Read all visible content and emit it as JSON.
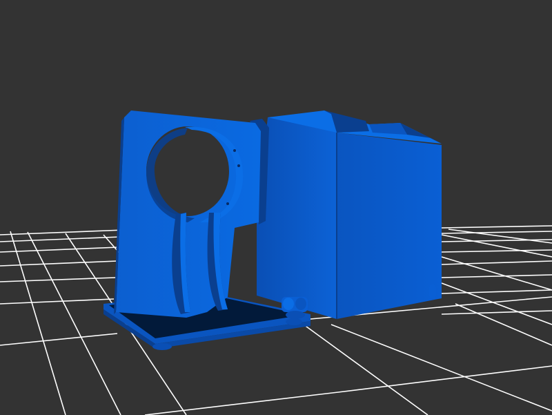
{
  "scene": {
    "background_color": "#333333",
    "grid_color": "#ffffff",
    "model_color": "#0a64d8",
    "model_dark": "#0a3f8f",
    "model_darker": "#062a66",
    "model_light": "#1a78ec"
  },
  "objects": [
    "ground-grid",
    "fan-duct-housing",
    "mounting-bracket-plate",
    "base-plate"
  ]
}
